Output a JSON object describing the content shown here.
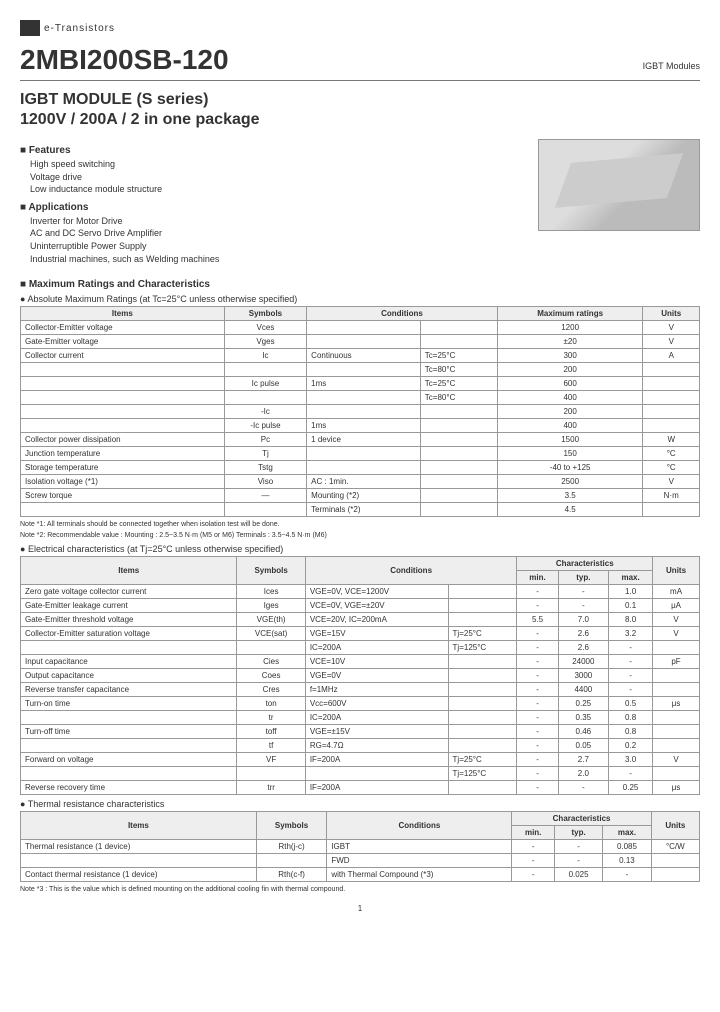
{
  "brand": "e-Transistors",
  "partNumber": "2MBI200SB-120",
  "category": "IGBT Modules",
  "titleLine1": "IGBT MODULE (S series)",
  "titleLine2": "1200V / 200A / 2 in one package",
  "features": {
    "heading": "Features",
    "items": [
      "High speed switching",
      "Voltage drive",
      "Low inductance module structure"
    ]
  },
  "applications": {
    "heading": "Applications",
    "items": [
      "Inverter for Motor Drive",
      "AC and DC Servo Drive Amplifier",
      "Uninterruptible Power Supply",
      "Industrial machines, such as Welding machines"
    ]
  },
  "maxRatings": {
    "heading": "Maximum Ratings and Characteristics",
    "sub": "Absolute Maximum Ratings (at Tc=25°C unless otherwise specified)",
    "headers": [
      "Items",
      "Symbols",
      "Conditions",
      "",
      "Maximum ratings",
      "Units"
    ],
    "rows": [
      [
        "Collector-Emitter voltage",
        "Vces",
        "",
        "",
        "1200",
        "V"
      ],
      [
        "Gate-Emitter voltage",
        "Vges",
        "",
        "",
        "±20",
        "V"
      ],
      [
        "Collector current",
        "Ic",
        "Continuous",
        "Tc=25°C",
        "300",
        "A"
      ],
      [
        "",
        "",
        "",
        "Tc=80°C",
        "200",
        ""
      ],
      [
        "",
        "Ic pulse",
        "1ms",
        "Tc=25°C",
        "600",
        ""
      ],
      [
        "",
        "",
        "",
        "Tc=80°C",
        "400",
        ""
      ],
      [
        "",
        "-Ic",
        "",
        "",
        "200",
        ""
      ],
      [
        "",
        "-Ic pulse",
        "1ms",
        "",
        "400",
        ""
      ],
      [
        "Collector power dissipation",
        "Pc",
        "1 device",
        "",
        "1500",
        "W"
      ],
      [
        "Junction temperature",
        "Tj",
        "",
        "",
        "150",
        "°C"
      ],
      [
        "Storage temperature",
        "Tstg",
        "",
        "",
        "-40 to +125",
        "°C"
      ],
      [
        "Isolation voltage (*1)",
        "Viso",
        "AC : 1min.",
        "",
        "2500",
        "V"
      ],
      [
        "Screw torque",
        "—",
        "Mounting (*2)",
        "",
        "3.5",
        "N·m"
      ],
      [
        "",
        "",
        "Terminals (*2)",
        "",
        "4.5",
        ""
      ]
    ],
    "notes": [
      "Note *1: All terminals should be connected together when isolation test will be done.",
      "Note *2: Recommendable value : Mounting : 2.5~3.5 N·m (M5 or M6)   Terminals : 3.5~4.5 N·m (M6)"
    ]
  },
  "elecChar": {
    "sub": "Electrical characteristics (at Tj=25°C unless otherwise specified)",
    "headers": [
      "Items",
      "Symbols",
      "Conditions",
      "",
      "min.",
      "typ.",
      "max.",
      "Units"
    ],
    "charCol": "Characteristics",
    "rows": [
      [
        "Zero gate voltage collector current",
        "Ices",
        "VGE=0V, VCE=1200V",
        "",
        "-",
        "-",
        "1.0",
        "mA"
      ],
      [
        "Gate-Emitter leakage current",
        "Iges",
        "VCE=0V, VGE=±20V",
        "",
        "-",
        "-",
        "0.1",
        "μA"
      ],
      [
        "Gate-Emitter threshold voltage",
        "VGE(th)",
        "VCE=20V, IC=200mA",
        "",
        "5.5",
        "7.0",
        "8.0",
        "V"
      ],
      [
        "Collector-Emitter saturation voltage",
        "VCE(sat)",
        "VGE=15V",
        "Tj=25°C",
        "-",
        "2.6",
        "3.2",
        "V"
      ],
      [
        "",
        "",
        "IC=200A",
        "Tj=125°C",
        "-",
        "2.6",
        "-",
        ""
      ],
      [
        "Input capacitance",
        "Cies",
        "VCE=10V",
        "",
        "-",
        "24000",
        "-",
        "pF"
      ],
      [
        "Output capacitance",
        "Coes",
        "VGE=0V",
        "",
        "-",
        "3000",
        "-",
        ""
      ],
      [
        "Reverse transfer capacitance",
        "Cres",
        "f=1MHz",
        "",
        "-",
        "4400",
        "-",
        ""
      ],
      [
        "Turn-on time",
        "ton",
        "Vcc=600V",
        "",
        "-",
        "0.25",
        "0.5",
        "μs"
      ],
      [
        "",
        "tr",
        "IC=200A",
        "",
        "-",
        "0.35",
        "0.8",
        ""
      ],
      [
        "Turn-off time",
        "toff",
        "VGE=±15V",
        "",
        "-",
        "0.46",
        "0.8",
        ""
      ],
      [
        "",
        "tf",
        "RG=4.7Ω",
        "",
        "-",
        "0.05",
        "0.2",
        ""
      ],
      [
        "Forward on voltage",
        "VF",
        "IF=200A",
        "Tj=25°C",
        "-",
        "2.7",
        "3.0",
        "V"
      ],
      [
        "",
        "",
        "",
        "Tj=125°C",
        "-",
        "2.0",
        "-",
        ""
      ],
      [
        "Reverse recovery time",
        "trr",
        "IF=200A",
        "",
        "-",
        "-",
        "0.25",
        "μs"
      ]
    ]
  },
  "thermal": {
    "sub": "Thermal resistance characteristics",
    "headers": [
      "Items",
      "Symbols",
      "Conditions",
      "min.",
      "typ.",
      "max.",
      "Units"
    ],
    "charCol": "Characteristics",
    "rows": [
      [
        "Thermal resistance (1 device)",
        "Rth(j-c)",
        "IGBT",
        "-",
        "-",
        "0.085",
        "°C/W"
      ],
      [
        "",
        "",
        "FWD",
        "-",
        "-",
        "0.13",
        ""
      ],
      [
        "Contact thermal resistance (1 device)",
        "Rth(c-f)",
        "with Thermal Compound (*3)",
        "-",
        "0.025",
        "-",
        ""
      ]
    ],
    "note": "Note *3 : This is the value which is defined mounting on the additional cooling fin with thermal compound."
  },
  "pageNum": "1"
}
